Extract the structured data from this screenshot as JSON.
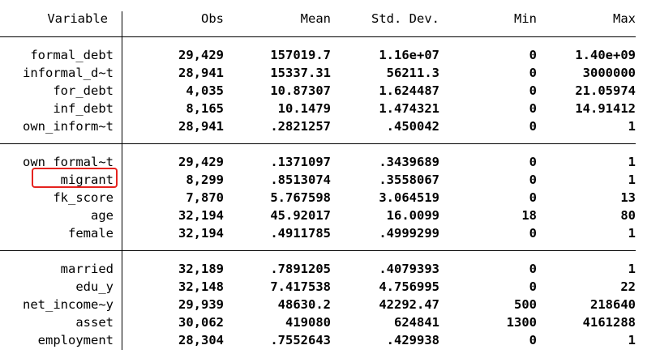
{
  "headers": {
    "variable": "Variable",
    "obs": "Obs",
    "mean": "Mean",
    "sd": "Std. Dev.",
    "min": "Min",
    "max": "Max"
  },
  "rows": [
    {
      "variable": "formal_debt",
      "obs": "29,429",
      "mean": "157019.7",
      "sd": "1.16e+07",
      "min": "0",
      "max": "1.40e+09"
    },
    {
      "variable": "informal_d~t",
      "obs": "28,941",
      "mean": "15337.31",
      "sd": "56211.3",
      "min": "0",
      "max": "3000000"
    },
    {
      "variable": "for_debt",
      "obs": "4,035",
      "mean": "10.87307",
      "sd": "1.624487",
      "min": "0",
      "max": "21.05974"
    },
    {
      "variable": "inf_debt",
      "obs": "8,165",
      "mean": "10.1479",
      "sd": "1.474321",
      "min": "0",
      "max": "14.91412"
    },
    {
      "variable": "own_inform~t",
      "obs": "28,941",
      "mean": ".2821257",
      "sd": ".450042",
      "min": "0",
      "max": "1"
    },
    {
      "variable": "own_formal~t",
      "obs": "29,429",
      "mean": ".1371097",
      "sd": ".3439689",
      "min": "0",
      "max": "1"
    },
    {
      "variable": "migrant",
      "obs": "8,299",
      "mean": ".8513074",
      "sd": ".3558067",
      "min": "0",
      "max": "1"
    },
    {
      "variable": "fk_score",
      "obs": "7,870",
      "mean": "5.767598",
      "sd": "3.064519",
      "min": "0",
      "max": "13"
    },
    {
      "variable": "age",
      "obs": "32,194",
      "mean": "45.92017",
      "sd": "16.0099",
      "min": "18",
      "max": "80"
    },
    {
      "variable": "female",
      "obs": "32,194",
      "mean": ".4911785",
      "sd": ".4999299",
      "min": "0",
      "max": "1"
    },
    {
      "variable": "married",
      "obs": "32,189",
      "mean": ".7891205",
      "sd": ".4079393",
      "min": "0",
      "max": "1"
    },
    {
      "variable": "edu_y",
      "obs": "32,148",
      "mean": "7.417538",
      "sd": "4.756995",
      "min": "0",
      "max": "22"
    },
    {
      "variable": "net_income~y",
      "obs": "29,939",
      "mean": "48630.2",
      "sd": "42292.47",
      "min": "500",
      "max": "218640"
    },
    {
      "variable": "asset",
      "obs": "30,062",
      "mean": "419080",
      "sd": "624841",
      "min": "1300",
      "max": "4161288"
    },
    {
      "variable": "employment",
      "obs": "28,304",
      "mean": ".7552643",
      "sd": ".429938",
      "min": "0",
      "max": "1"
    }
  ],
  "highlight_color": "#e5231f"
}
